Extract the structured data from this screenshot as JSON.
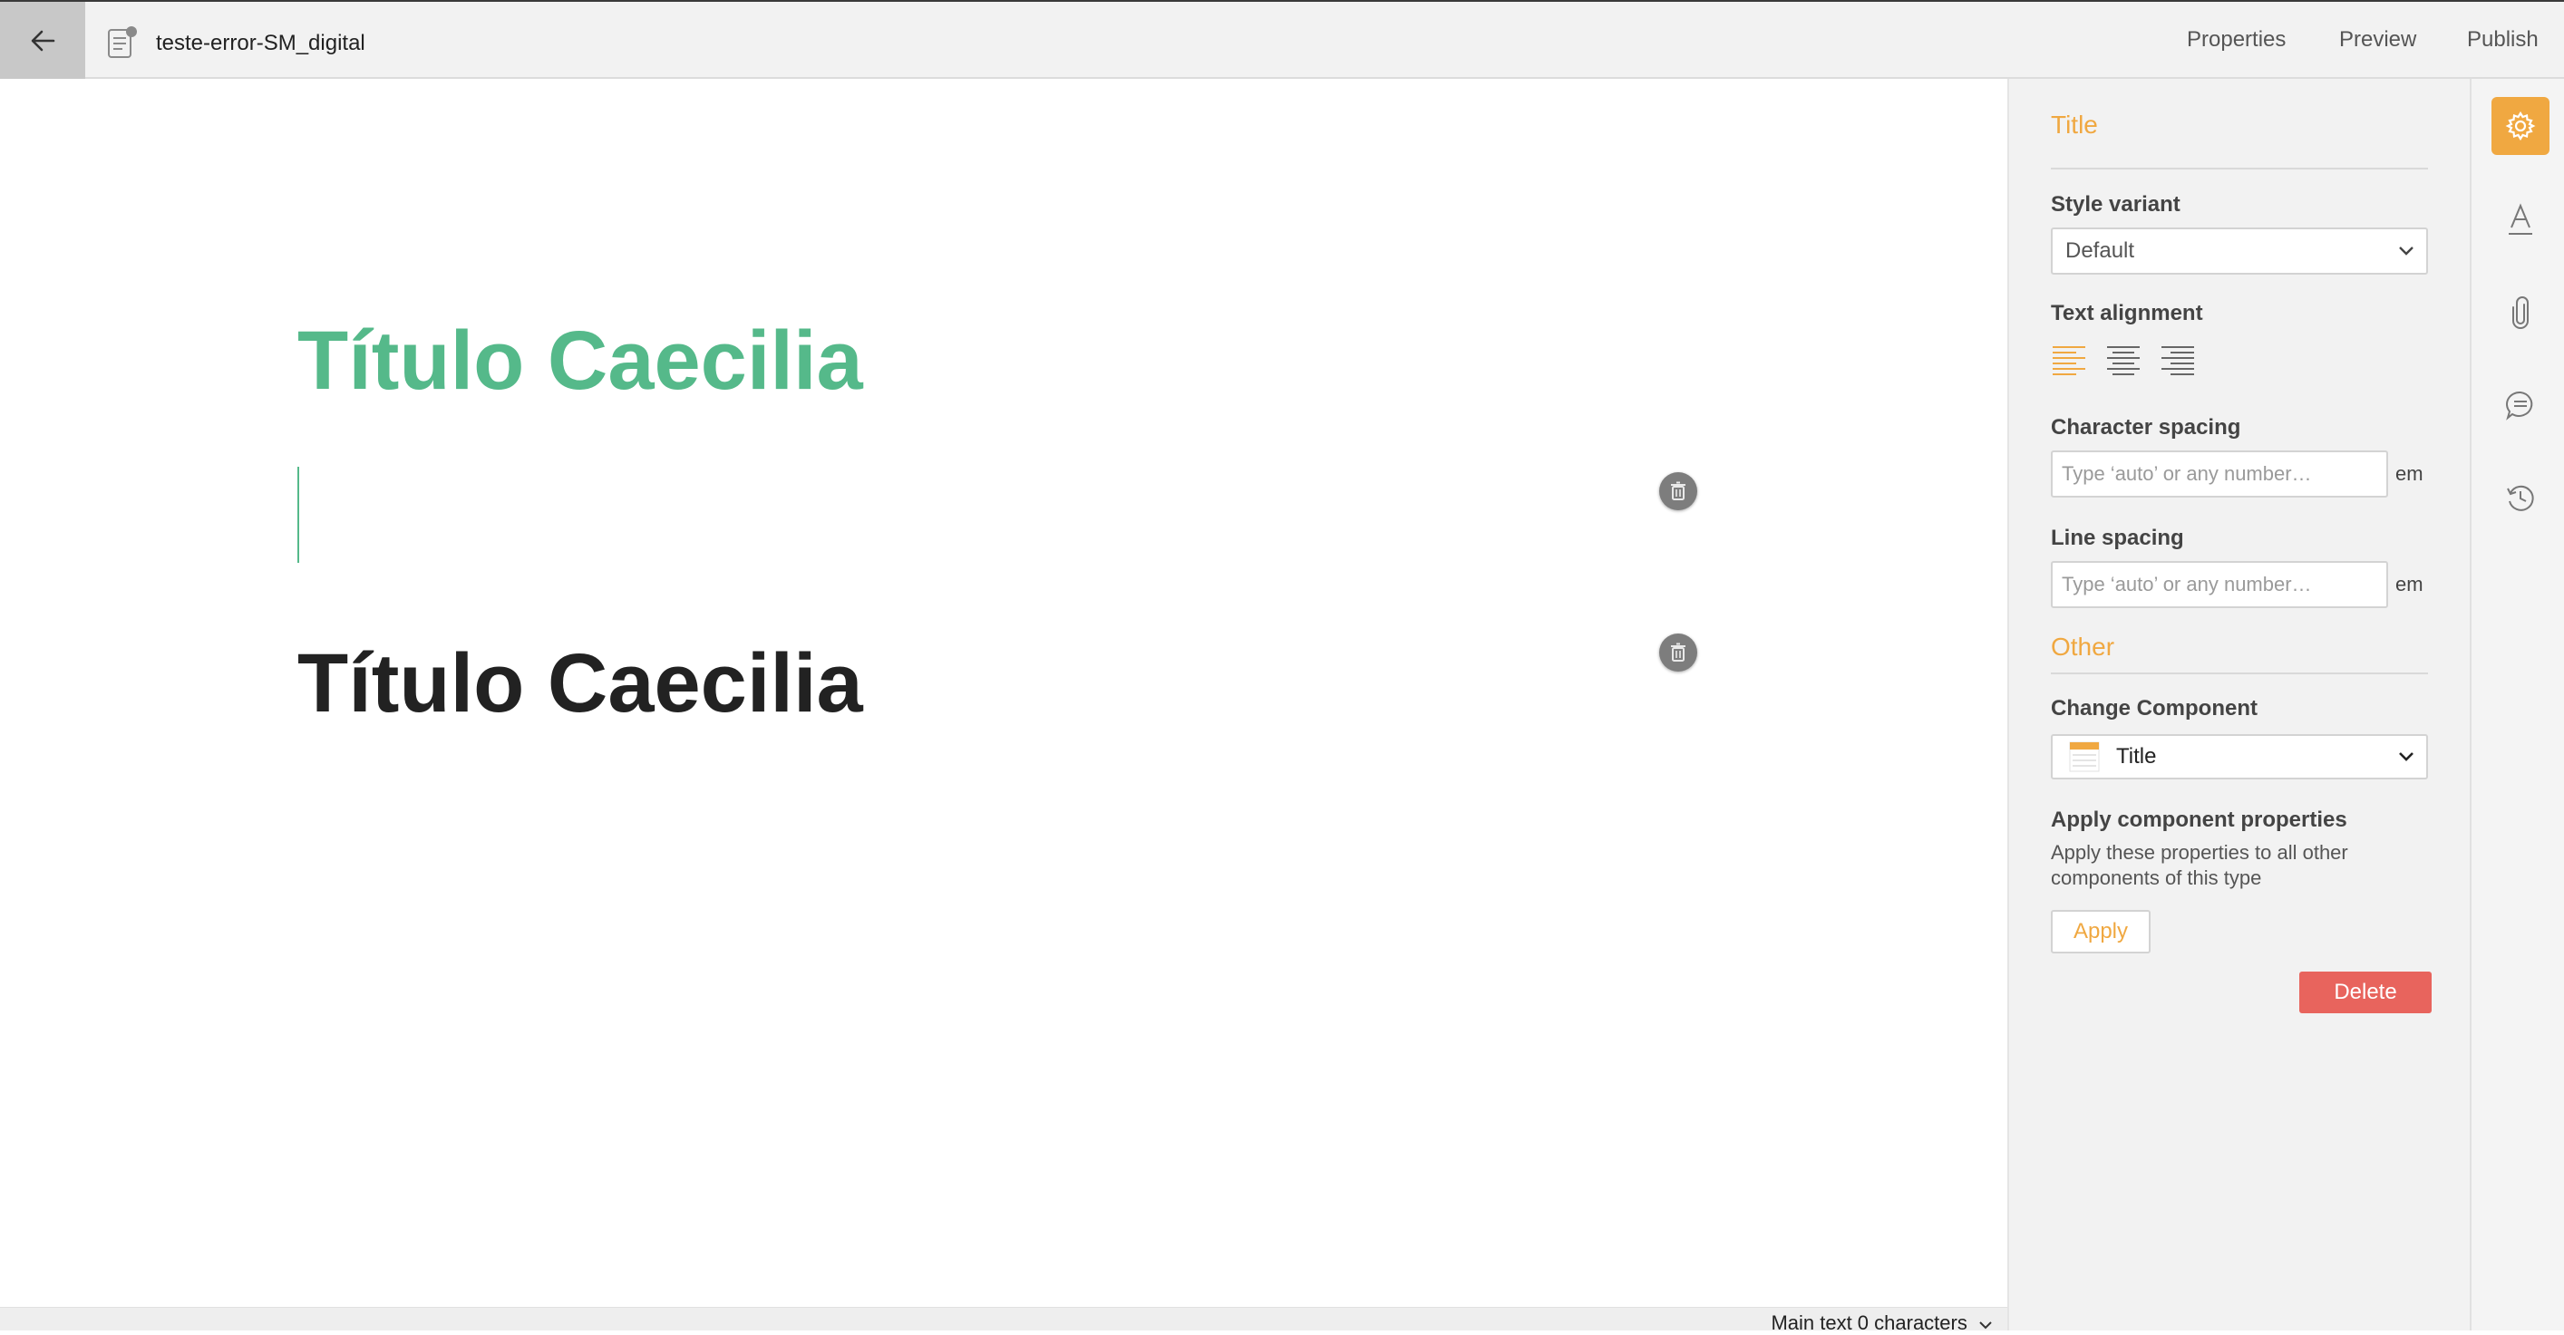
{
  "header": {
    "document_title": "teste-error-SM_digital",
    "nav": [
      "Properties",
      "Preview",
      "Publish"
    ]
  },
  "canvas": {
    "heading_green": "Título Caecilia",
    "heading_black": "Título Caecilia",
    "status_text": "Main text 0 characters"
  },
  "panel": {
    "section_title": "Title",
    "style_variant_label": "Style variant",
    "style_variant_value": "Default",
    "text_alignment_label": "Text alignment",
    "character_spacing_label": "Character spacing",
    "character_spacing_placeholder": "Type ‘auto’ or any number…",
    "line_spacing_label": "Line spacing",
    "line_spacing_placeholder": "Type ‘auto’ or any number…",
    "unit": "em",
    "other_title": "Other",
    "change_component_label": "Change Component",
    "change_component_value": "Title",
    "apply_props_label": "Apply component properties",
    "apply_props_desc": "Apply these properties to all other components of this type",
    "apply_button": "Apply",
    "delete_button": "Delete"
  },
  "rail": {
    "icons": [
      "gear-icon",
      "text-style-icon",
      "paperclip-icon",
      "comment-icon",
      "history-icon"
    ]
  },
  "colors": {
    "accent": "#f0a841",
    "heading_green": "#55b98a",
    "delete": "#e8645d"
  }
}
